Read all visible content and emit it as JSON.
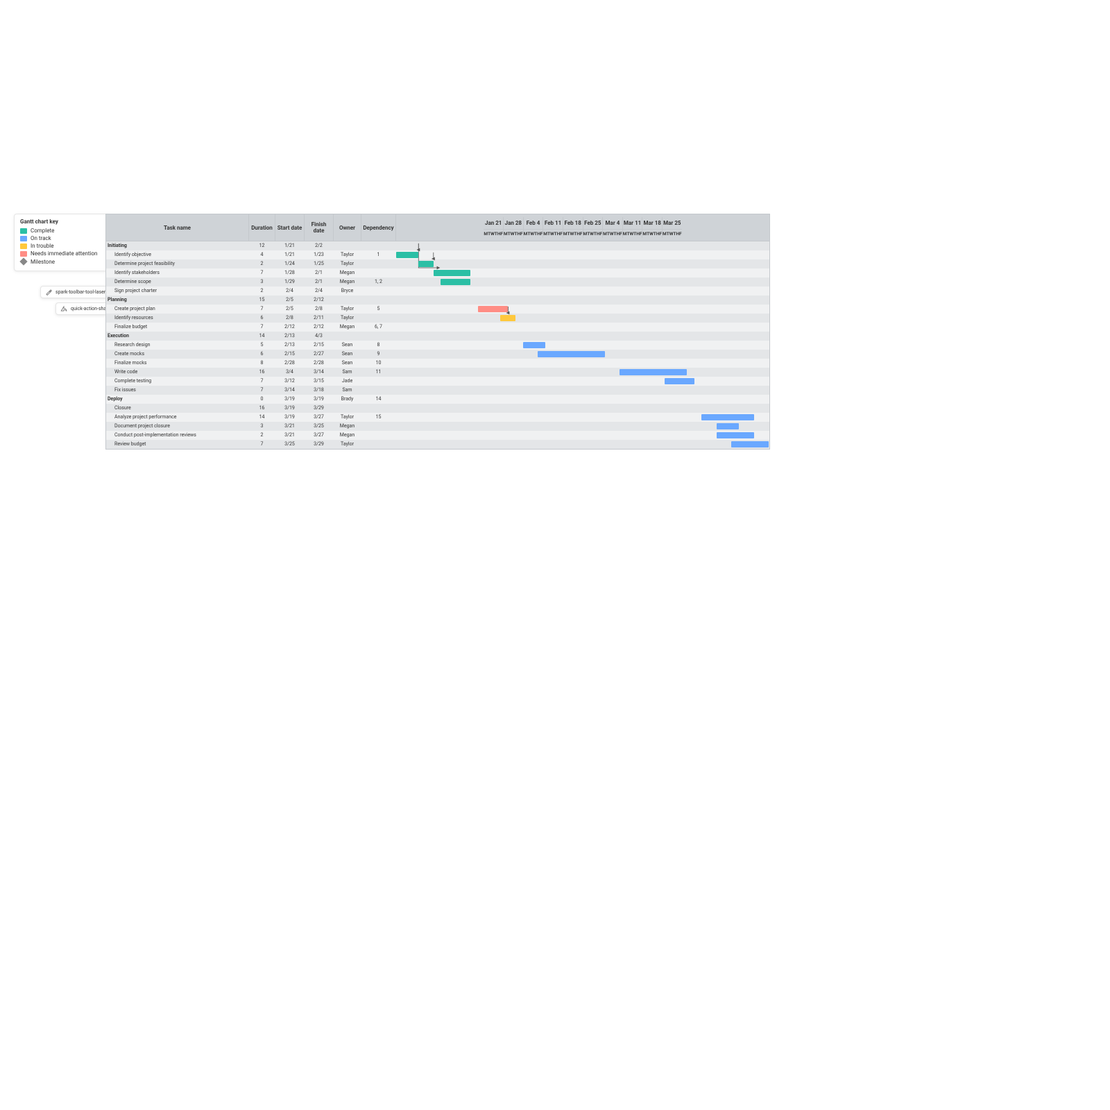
{
  "legend": {
    "title": "Gantt chart key",
    "items": [
      {
        "label": "Complete",
        "color": "#2bbfa5"
      },
      {
        "label": "On track",
        "color": "#6aa8ff"
      },
      {
        "label": "In trouble",
        "color": "#ffc83d"
      },
      {
        "label": "Needs immediate attention",
        "color": "#ff8d85"
      }
    ],
    "milestone": "Milestone"
  },
  "pills": {
    "laser": {
      "label": "spark-toolbar-tool-laser-pointer"
    },
    "share": {
      "label": "quick-action-share"
    }
  },
  "columns": {
    "task": "Task name",
    "duration": "Duration",
    "start": "Start date",
    "finish": "Finish date",
    "owner": "Owner",
    "dep": "Dependency"
  },
  "days": [
    "M",
    "T",
    "W",
    "TH",
    "F"
  ],
  "weeks": [
    "Jan 21",
    "Jan 28",
    "Feb 4",
    "Feb 11",
    "Feb 18",
    "Feb 25",
    "Mar 4",
    "Mar 11",
    "Mar 18",
    "Mar 25"
  ],
  "status_colors": {
    "complete": "#2bbfa5",
    "ontrack": "#6aa8ff",
    "trouble": "#ffc83d",
    "urgent": "#ff8d85"
  },
  "dep_arrows": [
    {
      "from_row": 1,
      "from_day": 3.0,
      "to_row": 2,
      "to_day": 3.0
    },
    {
      "from_row": 1,
      "from_day": 3.0,
      "to_row": 4,
      "to_day": 6.0
    },
    {
      "from_row": 2,
      "from_day": 5.0,
      "to_row": 3,
      "to_day": 5.0
    },
    {
      "from_row": 8,
      "from_day": 15.0,
      "to_row": 9,
      "to_day": 15.0
    }
  ],
  "rows": [
    {
      "type": "section",
      "task": "Initiating",
      "duration": "12",
      "start": "1/21",
      "finish": "2/2"
    },
    {
      "type": "task",
      "task": "Identify objective",
      "duration": "4",
      "start": "1/21",
      "finish": "1/23",
      "owner": "Taylor",
      "dep": "1",
      "bar": {
        "start": 0,
        "len": 3,
        "status": "complete"
      }
    },
    {
      "type": "task",
      "task": "Determine project feasibility",
      "duration": "2",
      "start": "1/24",
      "finish": "1/25",
      "owner": "Taylor",
      "bar": {
        "start": 3,
        "len": 2,
        "status": "complete"
      }
    },
    {
      "type": "task",
      "task": "Identify stakeholders",
      "duration": "7",
      "start": "1/28",
      "finish": "2/1",
      "owner": "Megan",
      "bar": {
        "start": 5,
        "len": 5,
        "status": "complete"
      }
    },
    {
      "type": "task",
      "task": "Determine scope",
      "duration": "3",
      "start": "1/29",
      "finish": "2/1",
      "owner": "Megan",
      "dep": "1, 2",
      "bar": {
        "start": 6,
        "len": 4,
        "status": "complete"
      }
    },
    {
      "type": "task",
      "task": "Sign project charter",
      "duration": "2",
      "start": "2/4",
      "finish": "2/4",
      "owner": "Bryce"
    },
    {
      "type": "section",
      "task": "Planning",
      "duration": "15",
      "start": "2/5",
      "finish": "2/12"
    },
    {
      "type": "task",
      "task": "Create project plan",
      "duration": "7",
      "start": "2/5",
      "finish": "2/8",
      "owner": "Taylor",
      "dep": "5",
      "bar": {
        "start": 11,
        "len": 4,
        "status": "urgent"
      }
    },
    {
      "type": "task",
      "task": "Identify resources",
      "duration": "6",
      "start": "2/8",
      "finish": "2/11",
      "owner": "Taylor",
      "bar": {
        "start": 14,
        "len": 2,
        "status": "trouble"
      }
    },
    {
      "type": "task",
      "task": "Finalize budget",
      "duration": "7",
      "start": "2/12",
      "finish": "2/12",
      "owner": "Megan",
      "dep": "6, 7"
    },
    {
      "type": "section",
      "task": "Execution",
      "duration": "14",
      "start": "2/13",
      "finish": "4/3"
    },
    {
      "type": "task",
      "task": "Research design",
      "duration": "5",
      "start": "2/13",
      "finish": "2/15",
      "owner": "Sean",
      "dep": "8",
      "bar": {
        "start": 17,
        "len": 3,
        "status": "ontrack"
      }
    },
    {
      "type": "task",
      "task": "Create mocks",
      "duration": "6",
      "start": "2/15",
      "finish": "2/27",
      "owner": "Sean",
      "dep": "9",
      "bar": {
        "start": 19,
        "len": 9,
        "status": "ontrack"
      }
    },
    {
      "type": "task",
      "task": "Finalize mocks",
      "duration": "8",
      "start": "2/28",
      "finish": "2/28",
      "owner": "Sean",
      "dep": "10"
    },
    {
      "type": "task",
      "task": "Write code",
      "duration": "16",
      "start": "3/4",
      "finish": "3/14",
      "owner": "Sam",
      "dep": "11",
      "bar": {
        "start": 30,
        "len": 9,
        "status": "ontrack"
      }
    },
    {
      "type": "task",
      "task": "Complete testing",
      "duration": "7",
      "start": "3/12",
      "finish": "3/15",
      "owner": "Jade",
      "bar": {
        "start": 36,
        "len": 4,
        "status": "ontrack"
      }
    },
    {
      "type": "task",
      "task": "Fix issues",
      "duration": "7",
      "start": "3/14",
      "finish": "3/18",
      "owner": "Sam"
    },
    {
      "type": "section",
      "task": "Deploy",
      "duration": "0",
      "start": "3/19",
      "finish": "3/19",
      "owner": "Brady",
      "dep": "14"
    },
    {
      "type": "task",
      "task": "Closure",
      "duration": "16",
      "start": "3/19",
      "finish": "3/29"
    },
    {
      "type": "task",
      "task": "Analyze project performance",
      "duration": "14",
      "start": "3/19",
      "finish": "3/27",
      "owner": "Taylor",
      "dep": "15",
      "bar": {
        "start": 41,
        "len": 7,
        "status": "ontrack"
      }
    },
    {
      "type": "task",
      "task": "Document project closure",
      "duration": "3",
      "start": "3/21",
      "finish": "3/25",
      "owner": "Megan",
      "bar": {
        "start": 43,
        "len": 3,
        "status": "ontrack"
      }
    },
    {
      "type": "task",
      "task": "Conduct post-implementation reviews",
      "duration": "2",
      "start": "3/21",
      "finish": "3/27",
      "owner": "Megan",
      "bar": {
        "start": 43,
        "len": 5,
        "status": "ontrack"
      }
    },
    {
      "type": "task",
      "task": "Review budget",
      "duration": "7",
      "start": "3/25",
      "finish": "3/29",
      "owner": "Taylor",
      "bar": {
        "start": 45,
        "len": 5,
        "status": "ontrack"
      }
    }
  ],
  "chart_data": {
    "type": "gantt",
    "title": "Gantt chart",
    "x_unit": "workday",
    "x_origin": "2019-01-21",
    "columns": [
      "Task name",
      "Duration",
      "Start date",
      "Finish date",
      "Owner",
      "Dependency"
    ],
    "weeks": [
      "Jan 21",
      "Jan 28",
      "Feb 4",
      "Feb 11",
      "Feb 18",
      "Feb 25",
      "Mar 4",
      "Mar 11",
      "Mar 18",
      "Mar 25"
    ],
    "status_palette": {
      "complete": "#2bbfa5",
      "ontrack": "#6aa8ff",
      "trouble": "#ffc83d",
      "urgent": "#ff8d85",
      "milestone": "#888"
    },
    "tasks": [
      {
        "id": 1,
        "group": "Initiating",
        "name": "Identify objective",
        "duration": 4,
        "start": "1/21",
        "finish": "1/23",
        "owner": "Taylor",
        "status": "complete",
        "bar_start_day": 0,
        "bar_len_days": 3
      },
      {
        "id": 2,
        "group": "Initiating",
        "name": "Determine project feasibility",
        "duration": 2,
        "start": "1/24",
        "finish": "1/25",
        "owner": "Taylor",
        "status": "complete",
        "bar_start_day": 3,
        "bar_len_days": 2,
        "depends_on": [
          1
        ]
      },
      {
        "id": 3,
        "group": "Initiating",
        "name": "Identify stakeholders",
        "duration": 7,
        "start": "1/28",
        "finish": "2/1",
        "owner": "Megan",
        "status": "complete",
        "bar_start_day": 5,
        "bar_len_days": 5,
        "depends_on": [
          2
        ]
      },
      {
        "id": 4,
        "group": "Initiating",
        "name": "Determine scope",
        "duration": 3,
        "start": "1/29",
        "finish": "2/1",
        "owner": "Megan",
        "status": "complete",
        "bar_start_day": 6,
        "bar_len_days": 4,
        "depends_on": [
          1,
          2
        ]
      },
      {
        "id": 5,
        "group": "Initiating",
        "name": "Sign project charter",
        "duration": 2,
        "start": "2/4",
        "finish": "2/4",
        "owner": "Bryce"
      },
      {
        "id": 6,
        "group": "Planning",
        "name": "Create project plan",
        "duration": 7,
        "start": "2/5",
        "finish": "2/8",
        "owner": "Taylor",
        "status": "urgent",
        "bar_start_day": 11,
        "bar_len_days": 4,
        "depends_on": [
          5
        ]
      },
      {
        "id": 7,
        "group": "Planning",
        "name": "Identify resources",
        "duration": 6,
        "start": "2/8",
        "finish": "2/11",
        "owner": "Taylor",
        "status": "trouble",
        "bar_start_day": 14,
        "bar_len_days": 2
      },
      {
        "id": 8,
        "group": "Planning",
        "name": "Finalize budget",
        "duration": 7,
        "start": "2/12",
        "finish": "2/12",
        "owner": "Megan",
        "depends_on": [
          6,
          7
        ]
      },
      {
        "id": 9,
        "group": "Execution",
        "name": "Research design",
        "duration": 5,
        "start": "2/13",
        "finish": "2/15",
        "owner": "Sean",
        "status": "ontrack",
        "bar_start_day": 17,
        "bar_len_days": 3,
        "depends_on": [
          8
        ]
      },
      {
        "id": 10,
        "group": "Execution",
        "name": "Create mocks",
        "duration": 6,
        "start": "2/15",
        "finish": "2/27",
        "owner": "Sean",
        "status": "ontrack",
        "bar_start_day": 19,
        "bar_len_days": 9,
        "depends_on": [
          9
        ]
      },
      {
        "id": 11,
        "group": "Execution",
        "name": "Finalize mocks",
        "duration": 8,
        "start": "2/28",
        "finish": "2/28",
        "owner": "Sean",
        "depends_on": [
          10
        ]
      },
      {
        "id": 12,
        "group": "Execution",
        "name": "Write code",
        "duration": 16,
        "start": "3/4",
        "finish": "3/14",
        "owner": "Sam",
        "status": "ontrack",
        "bar_start_day": 30,
        "bar_len_days": 9,
        "depends_on": [
          11
        ]
      },
      {
        "id": 13,
        "group": "Execution",
        "name": "Complete testing",
        "duration": 7,
        "start": "3/12",
        "finish": "3/15",
        "owner": "Jade",
        "status": "ontrack",
        "bar_start_day": 36,
        "bar_len_days": 4
      },
      {
        "id": 14,
        "group": "Execution",
        "name": "Fix issues",
        "duration": 7,
        "start": "3/14",
        "finish": "3/18",
        "owner": "Sam"
      },
      {
        "id": 15,
        "group": "Deploy",
        "name": "Closure",
        "duration": 16,
        "start": "3/19",
        "finish": "3/29"
      },
      {
        "id": 16,
        "group": "Deploy",
        "name": "Analyze project performance",
        "duration": 14,
        "start": "3/19",
        "finish": "3/27",
        "owner": "Taylor",
        "status": "ontrack",
        "bar_start_day": 41,
        "bar_len_days": 7,
        "depends_on": [
          15
        ]
      },
      {
        "id": 17,
        "group": "Deploy",
        "name": "Document project closure",
        "duration": 3,
        "start": "3/21",
        "finish": "3/25",
        "owner": "Megan",
        "status": "ontrack",
        "bar_start_day": 43,
        "bar_len_days": 3
      },
      {
        "id": 18,
        "group": "Deploy",
        "name": "Conduct post-implementation reviews",
        "duration": 2,
        "start": "3/21",
        "finish": "3/27",
        "owner": "Megan",
        "status": "ontrack",
        "bar_start_day": 43,
        "bar_len_days": 5
      },
      {
        "id": 19,
        "group": "Deploy",
        "name": "Review budget",
        "duration": 7,
        "start": "3/25",
        "finish": "3/29",
        "owner": "Taylor",
        "status": "ontrack",
        "bar_start_day": 45,
        "bar_len_days": 5
      }
    ]
  }
}
